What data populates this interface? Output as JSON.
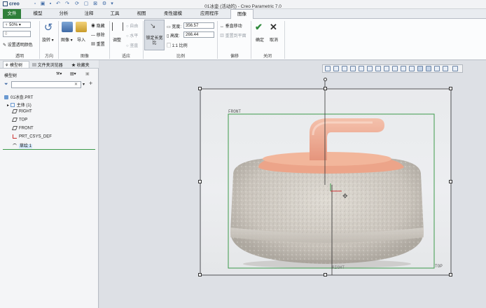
{
  "app": {
    "logo": "creo",
    "window_title": "01冰壶 (活动的) - Creo Parametric 7.0"
  },
  "menu": {
    "file": "文件",
    "model": "模型",
    "analysis": "分析",
    "annotate": "注释",
    "tools": "工具",
    "view": "视图",
    "flexible": "柔性建模",
    "apps": "应用程序",
    "image": "图像"
  },
  "ribbon": {
    "opacity_value": "50%",
    "opacity_field": "0",
    "set_transparency": "设置透明颜色",
    "group_transparency": "透明",
    "rotate": "旋转",
    "group_direction": "方向",
    "image_btn": "图像",
    "import_btn": "导入",
    "hide": "隐藏",
    "remove": "移除",
    "reset": "重置",
    "group_image": "图像",
    "adjust": "调整",
    "free": "自由",
    "horizontal": "水平",
    "vertical": "竖直",
    "group_fit": "适应",
    "fixed_ratio": "锁定长宽比",
    "width_label": "宽度:",
    "width_value": "356.57",
    "height_label": "高度:",
    "height_value": "266.44",
    "scale": "1:1 比例",
    "group_scale": "比例",
    "vertical_move": "垂直移动",
    "reset_plane": "重置到平面",
    "group_offset": "偏移",
    "ok": "确定",
    "cancel": "取消",
    "group_close": "关闭"
  },
  "panel": {
    "tab_model_tree": "模型树",
    "tab_file_browser": "文件夹浏览器",
    "tab_favorites": "收藏夹",
    "tree_title": "模型树",
    "items": [
      "01冰壶.PRT",
      "主体 (1)",
      "RIGHT",
      "TOP",
      "FRONT",
      "PRT_CSYS_DEF",
      "草绘 1"
    ]
  },
  "graphics": {
    "label_front": "FRONT",
    "label_top": "TOP",
    "label_right": "RIGHT"
  },
  "colors": {
    "file_tab": "#2f7f3a",
    "datum_green": "#3c9a4a",
    "accent_blue": "#3f6aa5"
  }
}
